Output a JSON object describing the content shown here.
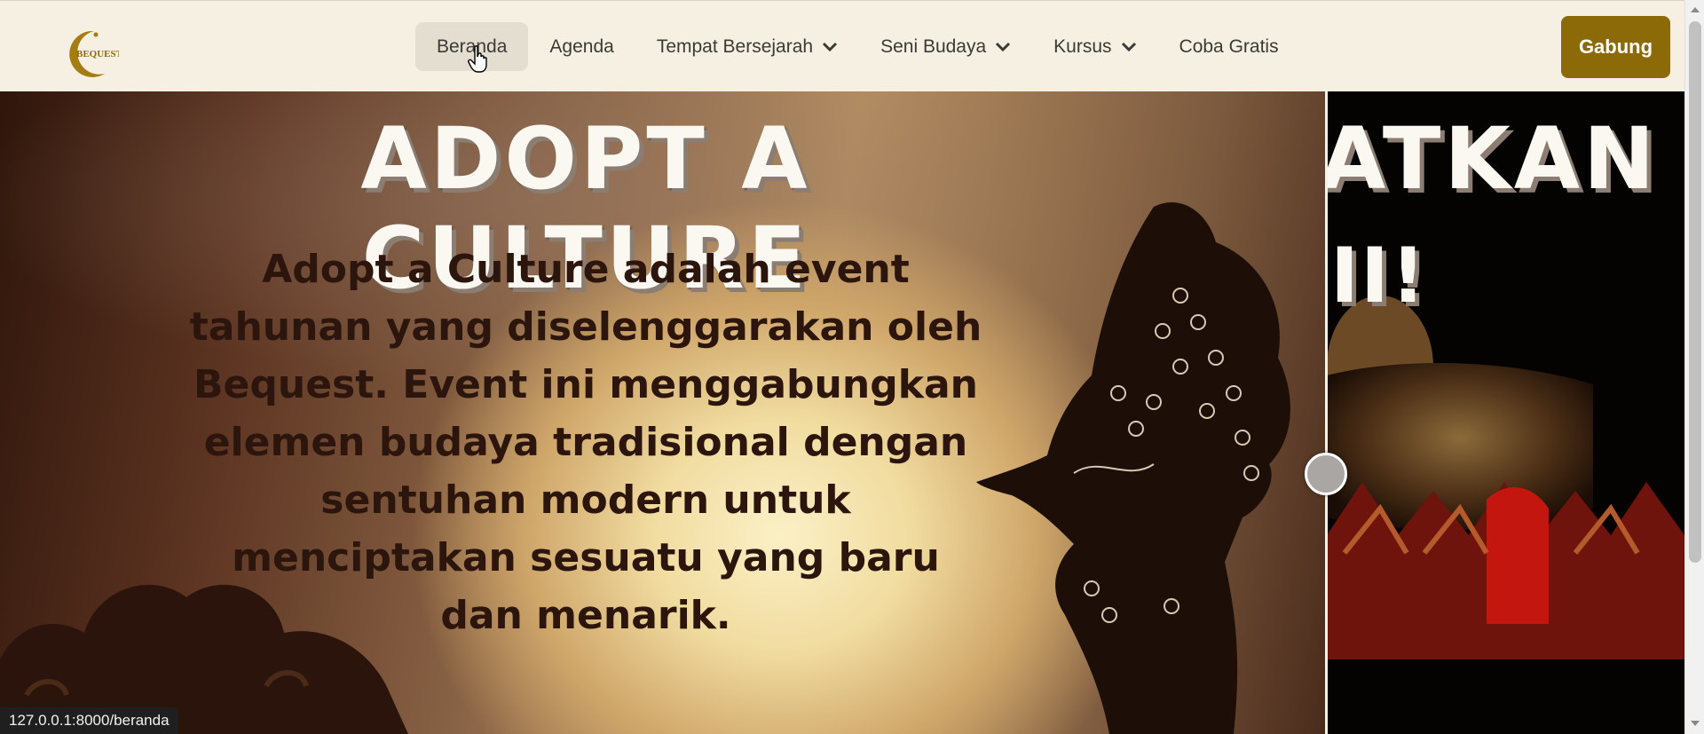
{
  "navbar": {
    "logo_text": "BEQUEST",
    "items": [
      {
        "label": "Beranda",
        "active": true,
        "dropdown": false
      },
      {
        "label": "Agenda",
        "active": false,
        "dropdown": false
      },
      {
        "label": "Tempat Bersejarah",
        "active": false,
        "dropdown": true
      },
      {
        "label": "Seni Budaya",
        "active": false,
        "dropdown": true
      },
      {
        "label": "Kursus",
        "active": false,
        "dropdown": true
      },
      {
        "label": "Coba Gratis",
        "active": false,
        "dropdown": false
      }
    ],
    "cta_label": "Gabung"
  },
  "hero": {
    "slide1_title": "ADOPT A CULTURE",
    "slide1_text": "Adopt a Culture adalah event tahunan yang diselenggarakan oleh Bequest. Event ini menggabungkan elemen budaya tradisional dengan sentuhan modern untuk menciptakan sesuatu yang baru dan menarik.",
    "slide2_title_fragment": "ATKAN",
    "slide2_exclaim": "II!"
  },
  "status_url": "127.0.0.1:8000/beranda",
  "colors": {
    "nav_bg": "#f5f0e1",
    "brand": "#8d6a08",
    "active_bg": "#e3ded0"
  }
}
